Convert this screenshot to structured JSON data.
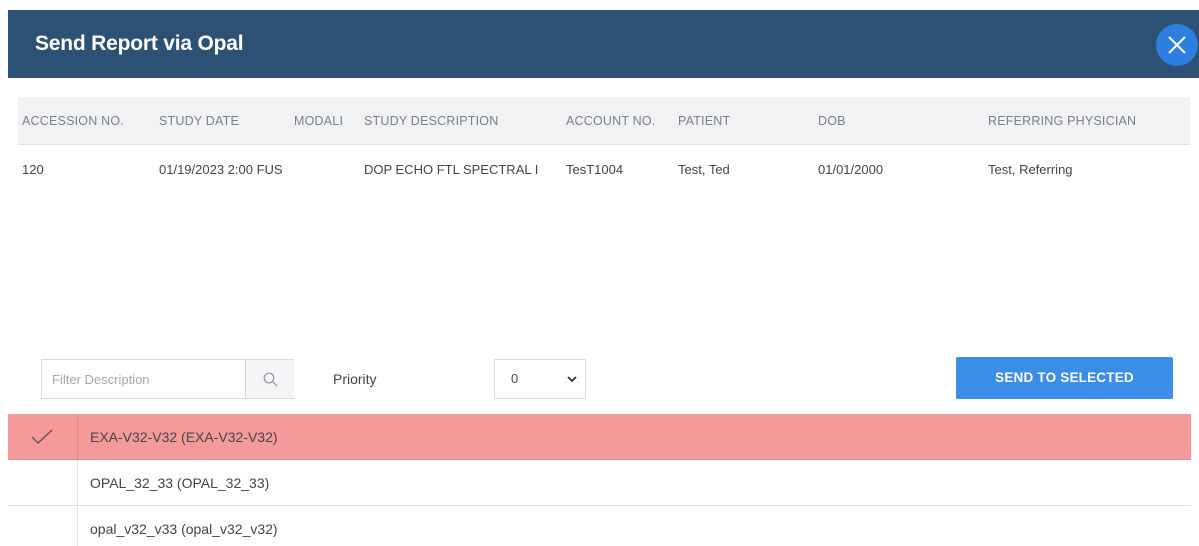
{
  "dialog": {
    "title": "Send Report via Opal"
  },
  "grid": {
    "columns": {
      "accession_no": "ACCESSION NO.",
      "study_date": "STUDY DATE",
      "modality": "MODALI",
      "study_description": "STUDY DESCRIPTION",
      "account_no": "ACCOUNT NO.",
      "patient": "PATIENT",
      "dob": "DOB",
      "referring_physician": "REFERRING PHYSICIAN"
    },
    "rows": [
      {
        "accession_no": "120",
        "study_date": "01/19/2023 2:00 FUS",
        "study_description": "DOP ECHO FTL SPECTRAL I",
        "account_no": "TesT1004",
        "patient": "Test, Ted",
        "dob": "01/01/2000",
        "referring_physician": "Test, Referring"
      }
    ]
  },
  "toolbar": {
    "filter_placeholder": "Filter Description",
    "filter_value": "",
    "priority_label": "Priority",
    "priority_value": "0",
    "send_button_label": "SEND TO SELECTED"
  },
  "destinations": [
    {
      "label": "EXA-V32-V32 (EXA-V32-V32)",
      "selected": true
    },
    {
      "label": "OPAL_32_33 (OPAL_32_33)",
      "selected": false
    },
    {
      "label": "opal_v32_v33 (opal_v32_v32)",
      "selected": false
    }
  ],
  "colors": {
    "header_bg": "#2d5075",
    "close_button_bg": "#2f7fe0",
    "send_button_bg": "#3b8ee8",
    "selected_row_bg": "#f59a9a"
  },
  "icons": {
    "close": "close-icon",
    "search": "search-icon",
    "dropdown": "chevron-down-icon",
    "check": "checkmark-icon"
  }
}
